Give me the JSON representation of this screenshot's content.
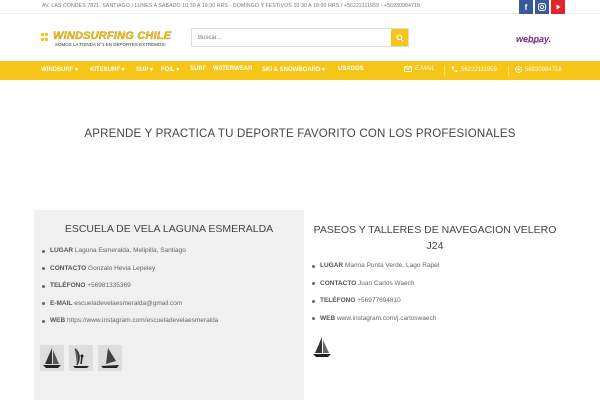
{
  "topbar": {
    "info": "AV. LAS CONDES 7821, SANTIAGO / LUNES A SÁBADO 10:30 A 19:30 HRS - DOMINGO Y FESTIVOS 10:30 A 18:00 HRS / +56222111959 - +56930984718",
    "social": [
      "facebook-icon",
      "instagram-icon",
      "youtube-icon"
    ]
  },
  "header": {
    "brand": "WINDSURFING CHILE",
    "tagline": "SOMOS LA TIENDA N°1 EN DEPORTES EXTREMOS!",
    "search_placeholder": "Buscar...",
    "payment_brand": "webpay.",
    "payment_sub": "Transbank"
  },
  "nav": {
    "items": [
      "WINDSURF",
      "KITESURF",
      "SUP",
      "FOIL",
      "SURF",
      "WATERWEAR",
      "SKI & SNOWBOARD",
      "USADOS"
    ],
    "email_label": "E-MAIL",
    "phone": "56222111959",
    "whatsapp": "56930984718"
  },
  "headline": "APRENDE Y PRACTICA TU DEPORTE FAVORITO CON LOS PROFESIONALES",
  "cards": [
    {
      "title": "ESCUELA DE VELA LAGUNA ESMERALDA",
      "lugar_label": "LUGAR",
      "lugar": "Laguna Esmeralda, Melipilla, Santiago",
      "contacto_label": "CONTACTO",
      "contacto": "Gonzalo Hevia Lepeley",
      "telefono_label": "TELÉFONO",
      "telefono": "+56981335369",
      "email_label": "E-MAIL",
      "email": "escueladevelaesmeralda@gmail.com",
      "web_label": "WEB",
      "web": "https://www.instagram.com/escueladevelaesmeralda"
    },
    {
      "title": "PASEOS Y TALLERES DE NAVEGACION VELERO J24",
      "lugar_label": "LUGAR",
      "lugar": "Marina Punta Verde, Lago Rapel",
      "contacto_label": "CONTACTO",
      "contacto": "Juan Carlos Waech",
      "telefono_label": "TELÉFONO",
      "telefono": "+56977694810",
      "web_label": "WEB",
      "web": "www.instagram.com/j.carloswaech"
    }
  ],
  "colors": {
    "accent": "#f5c518",
    "facebook": "#3b5998",
    "youtube": "#e0262a"
  }
}
